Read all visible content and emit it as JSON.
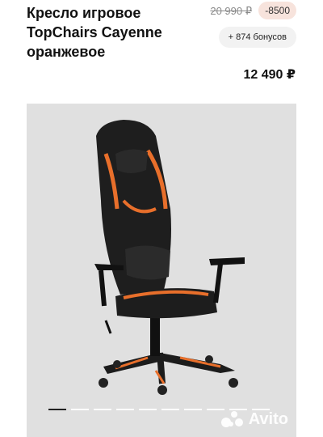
{
  "product": {
    "title": "Кресло игровое TopChairs Cayenne оранжевое",
    "old_price": "20 990 ₽",
    "discount": "-8500",
    "bonus": "+ 874 бонусов",
    "price": "12 490 ₽"
  },
  "gallery": {
    "image_icon": "gaming-chair-photo",
    "slide_count": 10,
    "active_index": 0,
    "watermark": "Avito",
    "watermark_icon": "avito-logo-icon"
  },
  "colors": {
    "accent": "#e86f2b",
    "chair_black": "#1d1d1d",
    "background_photo": "#e0e0e0",
    "discount_badge": "#f7e3dc"
  }
}
